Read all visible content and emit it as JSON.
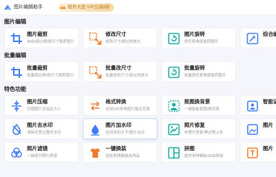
{
  "app": {
    "title": "图片编辑助手",
    "promo": "现开大促 VIP立减8折"
  },
  "sections": [
    {
      "title": "图片编辑",
      "tools": [
        {
          "name": "图片裁剪",
          "desc": "自由/按比例/按尺寸裁剪图片",
          "icon": "crop-icon"
        },
        {
          "name": "修改尺寸",
          "desc": "修改尺寸/按比例放大",
          "icon": "resize-icon"
        },
        {
          "name": "图片旋转",
          "desc": "按任意角度旋转图片",
          "icon": "rotate-icon"
        },
        {
          "name": "综合编辑",
          "desc": "",
          "icon": "edit-icon"
        }
      ]
    },
    {
      "title": "批量编辑",
      "tools": [
        {
          "name": "批量裁剪",
          "desc": "批量按比例/按尺寸裁剪图片",
          "icon": "batch-crop-icon"
        },
        {
          "name": "批量改尺寸",
          "desc": "批量修改尺寸/按比例放大",
          "icon": "batch-resize-icon"
        },
        {
          "name": "批量旋转",
          "desc": "批量按任意角度旋转图片",
          "icon": "batch-rotate-icon"
        },
        {
          "name": "",
          "desc": "",
          "icon": "blank"
        }
      ]
    },
    {
      "title": "特色功能",
      "tools": [
        {
          "name": "图片压缩",
          "desc": "压缩图片至指定大小",
          "icon": "compress-icon"
        },
        {
          "name": "格式转换",
          "desc": "支持100多种图片格式互换",
          "icon": "format-convert-icon"
        },
        {
          "name": "抠图换背景",
          "desc": "一键智能抠图/换背景",
          "icon": "cutout-icon"
        },
        {
          "name": "智能证件",
          "desc": "",
          "icon": "id-photo-icon"
        },
        {
          "name": "图片去水印",
          "desc": "清除任意位置的水印",
          "icon": "remove-watermark-icon"
        },
        {
          "name": "图片加水印",
          "desc": "支持添加文字/图片水印",
          "icon": "add-watermark-icon"
        },
        {
          "name": "照片修复",
          "desc": "老照片修复/黑白照上色",
          "icon": "photo-repair-icon"
        },
        {
          "name": "图片",
          "desc": "",
          "icon": "image-icon"
        },
        {
          "name": "照片滤镜",
          "desc": "一键提升照片质感",
          "icon": "filter-icon"
        },
        {
          "name": "一键换装",
          "desc": "轻松更换服装及饰品",
          "icon": "outfit-icon"
        },
        {
          "name": "拼图",
          "desc": "提供多种模板/自由拼接",
          "icon": "collage-icon"
        },
        {
          "name": "图片",
          "desc": "",
          "icon": "text-image-icon"
        }
      ]
    }
  ],
  "colors": {
    "icon_blue": "#3d7bf7",
    "icon_orange": "#f07b2e",
    "icon_teal": "#15a89b",
    "background": "#f4f6fb",
    "card": "#ffffff"
  }
}
